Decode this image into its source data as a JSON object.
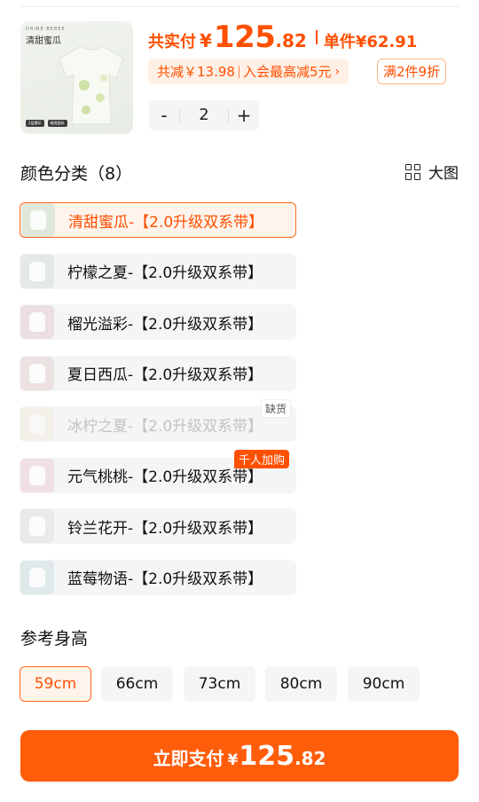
{
  "product": {
    "thumb_title": "清甜蜜瓜",
    "thumb_subtitle": "DRINE-BEBEE",
    "thumb_tags": [
      "2层模印",
      "精透面料"
    ]
  },
  "price": {
    "total_label": "共实付",
    "currency": "¥",
    "total_int": "125",
    "total_dec": ".82",
    "unit_label": "单件",
    "unit_price": "¥62.91"
  },
  "promo": {
    "discount": "共减￥13.98",
    "member": "入会最高减5元",
    "chevron": "›",
    "full_discount": "满2件9折"
  },
  "quantity": {
    "minus": "-",
    "value": "2",
    "plus": "+"
  },
  "color_section": {
    "title": "颜色分类（8）",
    "big_view": "大图",
    "options": [
      {
        "label": "清甜蜜瓜-【2.0升级双系带】",
        "state": "selected",
        "swatch": "#dfe8da"
      },
      {
        "label": "柠檬之夏-【2.0升级双系带】",
        "state": "normal",
        "swatch": "#e4e9e6"
      },
      {
        "label": "榴光溢彩-【2.0升级双系带】",
        "state": "normal",
        "swatch": "#ecdfe4"
      },
      {
        "label": "夏日西瓜-【2.0升级双系带】",
        "state": "normal",
        "swatch": "#ece2e2"
      },
      {
        "label": "冰柠之夏-【2.0升级双系带】",
        "state": "disabled",
        "swatch": "#f0ebd8"
      },
      {
        "label": "元气桃桃-【2.0升级双系带】",
        "state": "normal",
        "swatch": "#f0dfe4"
      },
      {
        "label": "铃兰花开-【2.0升级双系带】",
        "state": "normal",
        "swatch": "#e8ebe8"
      },
      {
        "label": "蓝莓物语-【2.0升级双系带】",
        "state": "normal",
        "swatch": "#e0e9ea"
      }
    ],
    "out_of_stock_badge": "缺货",
    "hot_badge": "千人加购"
  },
  "size_section": {
    "title": "参考身高",
    "options": [
      "59cm",
      "66cm",
      "73cm",
      "80cm",
      "90cm"
    ],
    "selected": "59cm"
  },
  "pay_button": {
    "label": "立即支付",
    "currency": "¥",
    "amount_int": "125",
    "amount_dec": ".82"
  },
  "colors": {
    "accent": "#ff5000",
    "button": "#ff5d0a",
    "chip_bg": "#f4f5f7"
  }
}
